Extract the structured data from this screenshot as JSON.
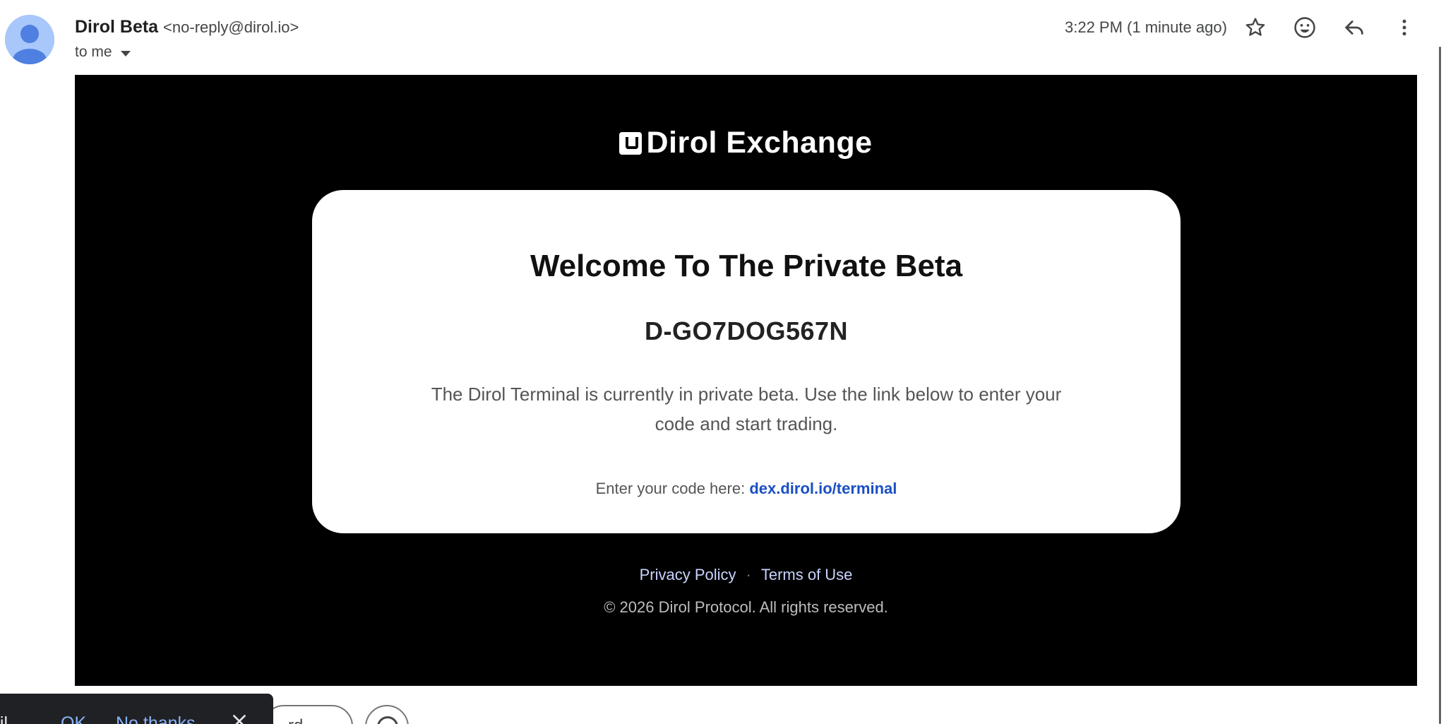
{
  "header": {
    "sender_name": "Dirol Beta",
    "sender_email": "<no-reply@dirol.io>",
    "recipient": "to me",
    "time": "3:22 PM (1 minute ago)",
    "icons": [
      "star-icon",
      "emoji-icon",
      "reply-icon",
      "more-vert-icon"
    ]
  },
  "email": {
    "brand": "Dirol Exchange",
    "title": "Welcome To The Private Beta",
    "code": "D-GO7DOG567N",
    "description": "The Dirol Terminal is currently in private beta. Use the link below to enter your code and start trading.",
    "enter_prefix": "Enter your code here:",
    "enter_link": "dex.dirol.io/terminal",
    "footer_links": [
      "Privacy Policy",
      "Terms of Use"
    ],
    "footer_separator": "·",
    "copyright": "© 2026 Dirol Protocol. All rights reserved."
  },
  "toast": {
    "message": "ail",
    "ok": "OK",
    "no_thanks": "No thanks"
  },
  "bottom_actions": {
    "partial_button_label": "rd"
  },
  "colors": {
    "email_bg": "#000000",
    "card_bg": "#ffffff",
    "link": "#1a4fc4",
    "footer_link": "#c9d3ff",
    "toast_bg": "#202124",
    "toast_action": "#8ab4f8"
  }
}
